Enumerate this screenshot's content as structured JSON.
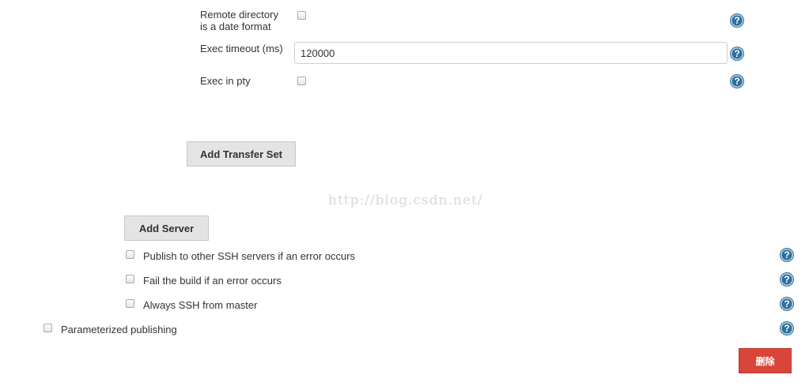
{
  "transfer": {
    "remote_dir_date_line1": "Remote directory",
    "remote_dir_date_line2": "is a date format",
    "exec_timeout_label": "Exec timeout (ms)",
    "exec_timeout_value": "120000",
    "exec_in_pty_label": "Exec in pty",
    "add_transfer_set_label": "Add Transfer Set"
  },
  "watermark": "http://blog.csdn.net/",
  "server": {
    "add_server_label": "Add Server",
    "options": [
      {
        "label": "Publish to other SSH servers if an error occurs",
        "checked": false
      },
      {
        "label": "Fail the build if an error occurs",
        "checked": false
      },
      {
        "label": "Always SSH from master",
        "checked": false
      }
    ]
  },
  "publishing": {
    "parameterized_label": "Parameterized publishing"
  },
  "delete_button_label": "删除",
  "help_glyph": "?",
  "icons": {
    "help": "help-icon"
  },
  "colors": {
    "help_blue": "#2e6f9e",
    "delete_red": "#d9453a",
    "button_gray": "#e4e4e4"
  }
}
